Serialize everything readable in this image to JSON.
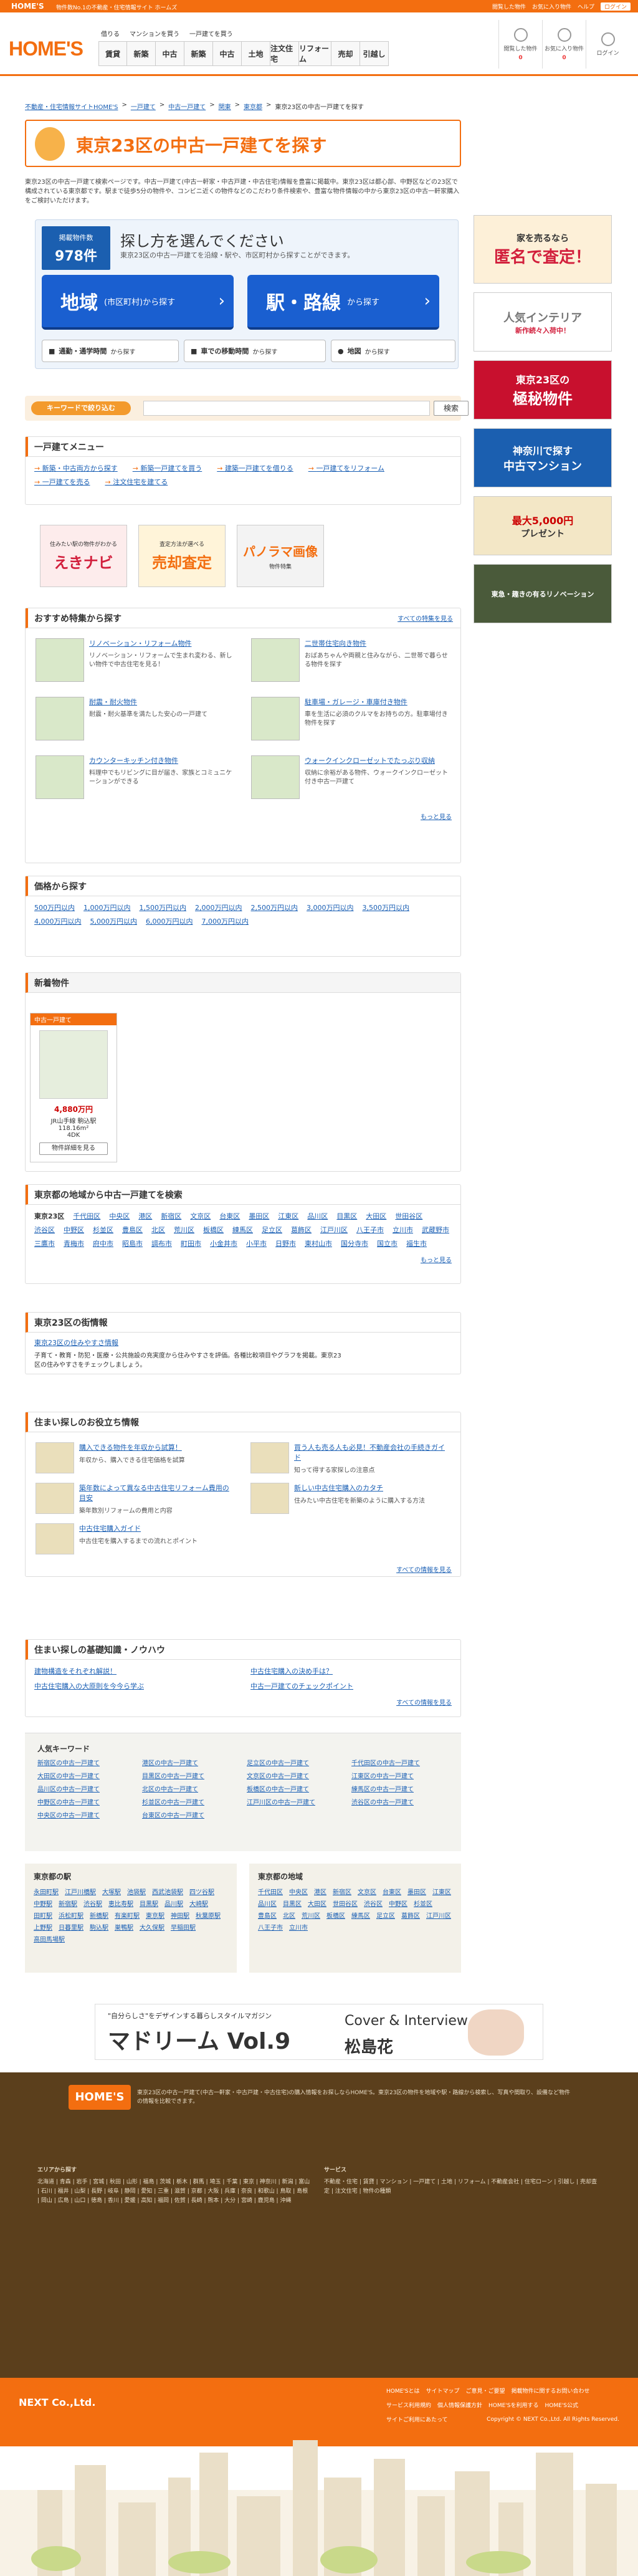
{
  "topbar": {
    "brand": "HOME'S",
    "tagline": "物件数No.1の不動産・住宅情報サイト ホームズ",
    "links": [
      "閲覧した物件",
      "お気に入り物件",
      "ヘルプ",
      "ログイン"
    ]
  },
  "header": {
    "logo": "HOME'S",
    "subnav": [
      "借りる",
      "マンションを買う",
      "一戸建てを買う"
    ],
    "tabs": [
      "賃貸",
      "新築",
      "中古",
      "新築",
      "中古",
      "土地",
      "注文住宅",
      "リフォーム",
      "売却",
      "引越し"
    ],
    "icons": [
      {
        "name": "history-icon",
        "label": "閲覧した物件",
        "count": "0"
      },
      {
        "name": "star-icon",
        "label": "お気に入り物件",
        "count": "0"
      },
      {
        "name": "user-icon",
        "label": "ログイン",
        "count": ""
      }
    ]
  },
  "breadcrumb": [
    "不動産・住宅情報サイトHOME'S",
    "一戸建て",
    "中古一戸建て",
    "関東",
    "東京都",
    "東京23区の中古一戸建てを探す"
  ],
  "title": "東京23区の中古一戸建てを探す",
  "intro": "東京23区の中古一戸建て検索ページです。中古一戸建て(中古一軒家・中古戸建・中古住宅)情報を豊富に掲載中。東京23区は都心部、中野区などの23区で構成されている東京都です。駅まで徒歩5分の物件や、コンビニ近くの物件などのこだわり条件検索や、豊富な物件情報の中から東京23区の中古一軒家購入をご検討いただけます。",
  "search": {
    "count_label": "掲載物件数",
    "count": "978件",
    "heading": "探し方を選んでください",
    "sub": "東京23区の中古一戸建てを沿線・駅や、市区町村から探すことができます。",
    "btn_area": "地域",
    "btn_area_sub": "(市区町村)から探す",
    "btn_station": "駅・路線",
    "btn_station_sub": "から探す",
    "btn_commute": "通勤・通学時間",
    "btn_commute_sub": "から探す",
    "btn_car": "車での移動時間",
    "btn_car_sub": "から探す",
    "btn_map": "地図",
    "btn_map_sub": "から探す"
  },
  "keyword": {
    "label": "キーワードで絞り込む",
    "placeholder": "",
    "button": "検索"
  },
  "menu": {
    "title": "一戸建てメニュー",
    "links": [
      "新築・中古両方から探す",
      "新築一戸建てを買う",
      "建築一戸建てを借りる",
      "一戸建てをリフォーム",
      "一戸建てを売る",
      "注文住宅を建てる"
    ]
  },
  "banners": [
    {
      "title": "えきナビ",
      "sub": "住みたい駅の物件がわかる"
    },
    {
      "title": "売却査定",
      "sub": "査定方法が選べる"
    },
    {
      "title": "パノラマ画像",
      "sub": "物件特集"
    }
  ],
  "features": {
    "title": "おすすめ特集から探す",
    "more": "すべての特集を見る",
    "items": [
      {
        "title": "リノベーション・リフォーム物件",
        "desc": "リノベーション・リフォームで生まれ変わる、新しい物件で中古住宅を見る！"
      },
      {
        "title": "二世帯住宅向き物件",
        "desc": "おばあちゃんや両親と住みながら、二世帯で暮らせる物件を探す"
      },
      {
        "title": "耐震・耐火物件",
        "desc": "耐震・耐火基準を満たした安心の一戸建て"
      },
      {
        "title": "駐車場・ガレージ・車庫付き物件",
        "desc": "車を生活に必須のクルマをお持ちの方。駐車場付き物件を探す"
      },
      {
        "title": "カウンターキッチン付き物件",
        "desc": "料理中でもリビングに目が届き、家族とコミュニケーションができる"
      },
      {
        "title": "ウォークインクローゼットでたっぷり収納",
        "desc": "収納に余裕がある物件、ウォークインクローゼット付き中古一戸建て"
      }
    ],
    "more_btn": "もっと見る"
  },
  "price": {
    "title": "価格から探す",
    "links": [
      "500万円以内",
      "1,000万円以内",
      "1,500万円以内",
      "2,000万円以内",
      "2,500万円以内",
      "3,000万円以内",
      "3,500万円以内",
      "4,000万円以内",
      "5,000万円以内",
      "6,000万円以内",
      "7,000万円以内"
    ]
  },
  "new_listing": {
    "title": "新着物件",
    "label": "中古一戸建て",
    "price": "4,880万円",
    "station": "JR山手線 駒込駅",
    "area": "118.16m²",
    "layout": "4DK",
    "btn": "物件詳細を見る"
  },
  "areas": {
    "title": "東京都の地域から中古一戸建てを検索",
    "items": [
      "東京23区",
      "千代田区",
      "中央区",
      "港区",
      "新宿区",
      "文京区",
      "台東区",
      "墨田区",
      "江東区",
      "品川区",
      "目黒区",
      "大田区",
      "世田谷区",
      "渋谷区",
      "中野区",
      "杉並区",
      "豊島区",
      "北区",
      "荒川区",
      "板橋区",
      "練馬区",
      "足立区",
      "葛飾区",
      "江戸川区",
      "八王子市",
      "立川市",
      "武蔵野市",
      "三鷹市",
      "青梅市",
      "府中市",
      "昭島市",
      "調布市",
      "町田市",
      "小金井市",
      "小平市",
      "日野市",
      "東村山市",
      "国分寺市",
      "国立市",
      "福生市"
    ],
    "more": "もっと見る"
  },
  "market": {
    "title": "東京23区の街情報",
    "link": "東京23区の住みやすさ情報",
    "desc": "子育て・教育・防犯・医療・公共施設の充実度から住みやすさを評価。各種比較項目やグラフを掲載。東京23区の住みやすさをチェックしましょう。"
  },
  "info": {
    "title": "住まい探しのお役立ち情報",
    "items": [
      {
        "title": "購入できる物件を年収から試算！",
        "desc": "年収から、購入できる住宅価格を試算"
      },
      {
        "title": "買う人も売る人も必見！不動産会社の手続きガイド",
        "desc": "知って得する家探しの注意点"
      },
      {
        "title": "築年数によって異なる中古住宅リフォーム費用の目安",
        "desc": "築年数別リフォームの費用と内容"
      },
      {
        "title": "新しい中古住宅購入のカタチ",
        "desc": "住みたい中古住宅を新築のように購入する方法"
      },
      {
        "title": "中古住宅購入ガイド",
        "desc": "中古住宅を購入するまでの流れとポイント"
      }
    ],
    "more": "すべての情報を見る"
  },
  "knowhow": {
    "title": "住まい探しの基礎知識・ノウハウ",
    "links": [
      "建物構造をそれぞれ解説！",
      "中古住宅購入の決め手は？",
      "中古住宅購入の大原則を今今ら学ぶ",
      "中古一戸建てのチェックポイント"
    ],
    "more": "すべての情報を見る"
  },
  "popular": {
    "title": "人気キーワード",
    "items": [
      "新宿区の中古一戸建て",
      "港区の中古一戸建て",
      "足立区の中古一戸建て",
      "千代田区の中古一戸建て",
      "大田区の中古一戸建て",
      "目黒区の中古一戸建て",
      "文京区の中古一戸建て",
      "江東区の中古一戸建て",
      "品川区の中古一戸建て",
      "北区の中古一戸建て",
      "板橋区の中古一戸建て",
      "練馬区の中古一戸建て",
      "中野区の中古一戸建て",
      "杉並区の中古一戸建て",
      "江戸川区の中古一戸建て",
      "渋谷区の中古一戸建て",
      "中央区の中古一戸建て",
      "台東区の中古一戸建て"
    ]
  },
  "stations": {
    "title": "東京都の駅",
    "items": [
      "永田町駅",
      "江戸川橋駅",
      "大塚駅",
      "池袋駅",
      "西武池袋駅",
      "四ツ谷駅",
      "中野駅",
      "新宿駅",
      "渋谷駅",
      "恵比寿駅",
      "目黒駅",
      "品川駅",
      "大崎駅",
      "田町駅",
      "浜松町駅",
      "新橋駅",
      "有楽町駅",
      "東京駅",
      "神田駅",
      "秋葉原駅",
      "上野駅",
      "日暮里駅",
      "駒込駅",
      "巣鴨駅",
      "大久保駅",
      "早稲田駅",
      "高田馬場駅"
    ]
  },
  "cities": {
    "title": "東京都の地域",
    "items": [
      "千代田区",
      "中央区",
      "港区",
      "新宿区",
      "文京区",
      "台東区",
      "墨田区",
      "江東区",
      "品川区",
      "目黒区",
      "大田区",
      "世田谷区",
      "渋谷区",
      "中野区",
      "杉並区",
      "豊島区",
      "北区",
      "荒川区",
      "板橋区",
      "練馬区",
      "足立区",
      "葛飾区",
      "江戸川区",
      "八王子市",
      "立川市"
    ]
  },
  "magazine": {
    "tagline": "\"自分らしさ\"をデザインする暮らしスタイルマガジン",
    "title": "マドリーム Vol.9",
    "cover": "Cover & Interview",
    "person": "松島花"
  },
  "sidebar": [
    {
      "title": "家を売るなら",
      "sub": "匿名で査定！",
      "color": "#f39a2d"
    },
    {
      "title": "人気インテリア",
      "sub": "新作続々入荷中！",
      "color": "#ffffff"
    },
    {
      "title": "東京23区の",
      "sub": "極秘物件",
      "color": "#c8102e"
    },
    {
      "title": "神奈川で探す",
      "sub": "中古マンション",
      "color": "#1b5fb0"
    },
    {
      "title": "最大5,000円",
      "sub": "プレゼント",
      "color": "#f3e7c6"
    },
    {
      "title": "東急・趣きの有るリノベーション",
      "sub": "",
      "color": "#4a5a3a"
    }
  ],
  "footer": {
    "logo": "HOME'S",
    "desc": "東京23区の中古一戸建て(中古一軒家・中古戸建・中古住宅)の購入情報をお探しならHOME'S。東京23区の物件を地域や駅・路線から検索し、写真や間取り、設備など物件の情報を比較できます。",
    "col1_title": "エリアから探す",
    "col1": "北海道 | 青森 | 岩手 | 宮城 | 秋田 | 山形 | 福島 | 茨城 | 栃木 | 群馬 | 埼玉 | 千葉 | 東京 | 神奈川 | 新潟 | 富山 | 石川 | 福井 | 山梨 | 長野 | 岐阜 | 静岡 | 愛知 | 三重 | 滋賀 | 京都 | 大阪 | 兵庫 | 奈良 | 和歌山 | 鳥取 | 島根 | 岡山 | 広島 | 山口 | 徳島 | 香川 | 愛媛 | 高知 | 福岡 | 佐賀 | 長崎 | 熊本 | 大分 | 宮崎 | 鹿児島 | 沖縄",
    "col2_title": "サービス",
    "col2": "不動産・住宅 | 賃貸 | マンション | 一戸建て | 土地 | リフォーム | 不動産会社 | 住宅ローン | 引越し | 売却査定 | 注文住宅 | 物件の種類"
  },
  "bottom": {
    "company": "NEXT Co.,Ltd.",
    "links": [
      "HOME'Sとは",
      "サイトマップ",
      "ご意見・ご要望",
      "掲載物件に関するお問い合わせ",
      "サービス利用規約",
      "個人情報保護方針",
      "HOME'Sを利用する",
      "HOME'S公式",
      "サイトご利用にあたって"
    ],
    "copyright": "Copyright © NEXT Co.,Ltd. All Rights Reserved."
  }
}
